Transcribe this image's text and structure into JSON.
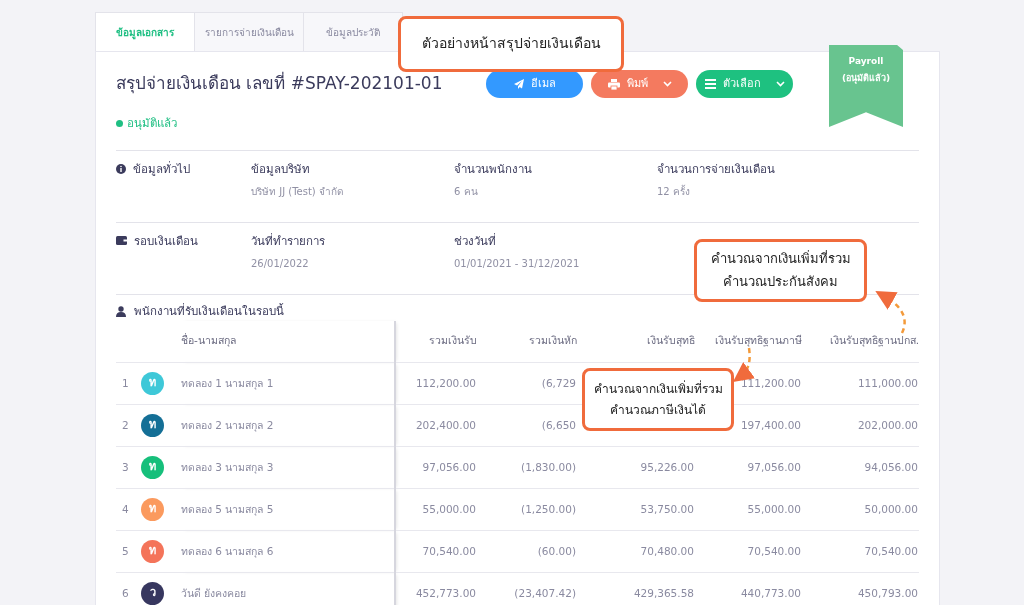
{
  "tabs": [
    {
      "label": "ข้อมูลเอกสาร",
      "selected": true
    },
    {
      "label": "รายการจ่ายเงินเดือน",
      "selected": false
    },
    {
      "label": "ข้อมูลประวัติ",
      "selected": false
    }
  ],
  "document": {
    "title": "สรุปจ่ายเงินเดือน เลขที่ #SPAY-202101-01",
    "status": "อนุมัติแล้ว",
    "ribbon": {
      "line_1": "Payroll",
      "line_2": "(อนุมัติแล้ว)"
    },
    "buttons": [
      {
        "kind": "email",
        "label": "อีเมล",
        "dropdown": false
      },
      {
        "kind": "print",
        "label": "พิมพ์",
        "dropdown": true
      },
      {
        "kind": "options",
        "label": "ตัวเลือก",
        "dropdown": true
      }
    ]
  },
  "sections": [
    {
      "kind": "info",
      "heading": "ข้อมูลทั่วไป",
      "fields": [
        {
          "label": "ข้อมูลบริษัท",
          "value": "บริษัท JJ (Test) จำกัด"
        },
        {
          "label": "จำนวนพนักงาน",
          "value": "6 คน"
        },
        {
          "label": "จำนวนการจ่ายเงินเดือน",
          "value": "12 ครั้ง"
        }
      ]
    },
    {
      "kind": "wallet",
      "heading": "รอบเงินเดือน",
      "fields": [
        {
          "label": "วันที่ทำรายการ",
          "value": "26/01/2022"
        },
        {
          "label": "ช่วงวันที่",
          "value": "01/01/2021 - 31/12/2021"
        }
      ]
    }
  ],
  "employees": {
    "heading": "พนักงานที่รับเงินเดือนในรอบนี้",
    "columns": [
      "ชื่อ-นามสกุล",
      "รวมเงินรับ",
      "รวมเงินหัก",
      "เงินรับสุทธิ",
      "เงินรับสุทธิฐานภาษี",
      "เงินรับสุทธิฐานปกส."
    ],
    "rows": [
      {
        "index": "1",
        "initial": "ท",
        "color": "#3ec8d8",
        "cells": [
          "ทดลอง 1 นามสกุล 1",
          "112,200.00",
          "(6,729",
          "",
          "111,200.00",
          "111,000.00"
        ]
      },
      {
        "index": "2",
        "initial": "ท",
        "color": "#146f96",
        "cells": [
          "ทดลอง 2 นามสกุล 2",
          "202,400.00",
          "(6,650",
          "",
          "197,400.00",
          "202,000.00"
        ]
      },
      {
        "index": "3",
        "initial": "ท",
        "color": "#16bf7b",
        "cells": [
          "ทดลอง 3 นามสกุล 3",
          "97,056.00",
          "(1,830.00)",
          "95,226.00",
          "97,056.00",
          "94,056.00"
        ]
      },
      {
        "index": "4",
        "initial": "ท",
        "color": "#fb9a5e",
        "cells": [
          "ทดลอง 5 นามสกุล 5",
          "55,000.00",
          "(1,250.00)",
          "53,750.00",
          "55,000.00",
          "50,000.00"
        ]
      },
      {
        "index": "5",
        "initial": "ท",
        "color": "#f4745a",
        "cells": [
          "ทดลอง 6 นามสกุล 6",
          "70,540.00",
          "(60.00)",
          "70,480.00",
          "70,540.00",
          "70,540.00"
        ]
      },
      {
        "index": "6",
        "initial": "ว",
        "color": "#37375f",
        "cells": [
          "วันดี ยังคงคอย",
          "452,773.00",
          "(23,407.42)",
          "429,365.58",
          "440,773.00",
          "450,793.00"
        ]
      }
    ]
  },
  "callouts": [
    {
      "text": "ตัวอย่างหน้าสรุปจ่ายเงินเดือน"
    },
    {
      "text": "คำนวณจากเงินเพิ่มที่รวมคำนวณประกันสังคม"
    },
    {
      "text": "คำนวณจากเงินเพิ่มที่รวมคำนวณภาษีเงินได้"
    }
  ]
}
